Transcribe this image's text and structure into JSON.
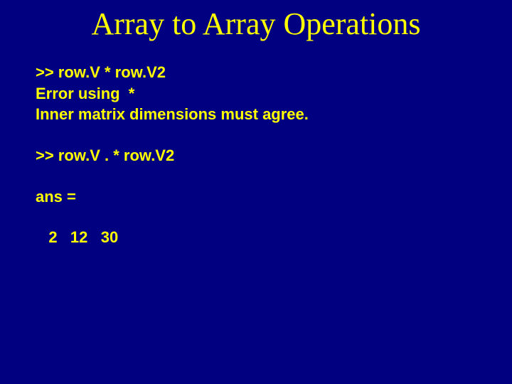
{
  "title": "Array to Array Operations",
  "lines": {
    "l1": ">> row.V * row.V2",
    "l2": "Error using  *",
    "l3": "Inner matrix dimensions must agree.",
    "l4": ">> row.V . * row.V2",
    "l5": "ans =",
    "l6": "   2   12   30"
  }
}
